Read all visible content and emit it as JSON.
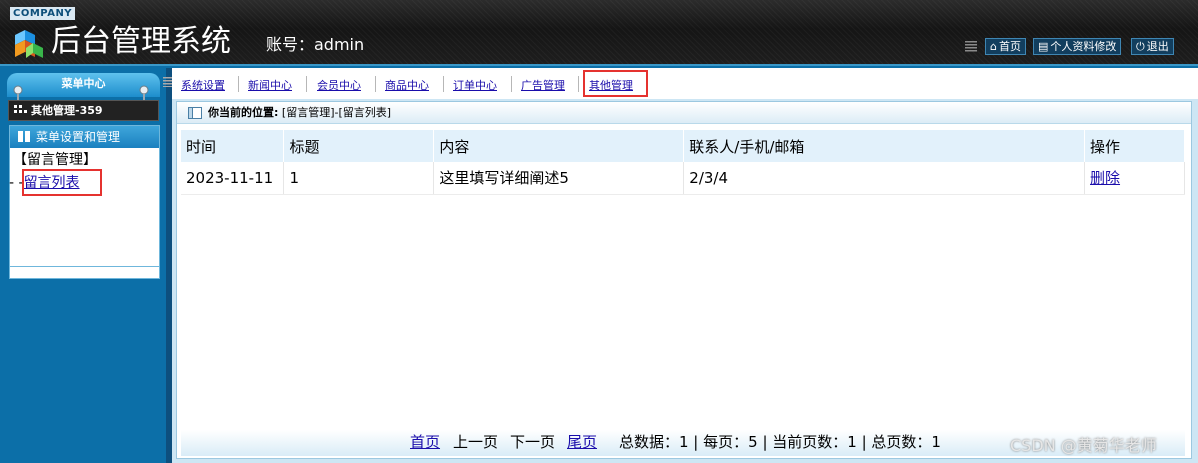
{
  "header": {
    "company": "COMPANY",
    "title": "后台管理系统",
    "account": "账号：admin",
    "buttons": [
      {
        "label": "首页",
        "icon": "home-icon"
      },
      {
        "label": "个人资料修改",
        "icon": "profile-icon"
      },
      {
        "label": "退出",
        "icon": "power-icon"
      }
    ]
  },
  "sidebar": {
    "menu_center": "菜单中心",
    "section": "其他管理-359",
    "panel_title": "菜单设置和管理",
    "group": "【留言管理】",
    "item_prefix": "- -",
    "item": "留言列表"
  },
  "nav": {
    "tabs": [
      "系统设置",
      "新闻中心",
      "会员中心",
      "商品中心",
      "订单中心",
      "广告管理",
      "其他管理"
    ]
  },
  "breadcrumb": {
    "prefix": "你当前的位置:",
    "path": "[留言管理]-[留言列表]"
  },
  "table": {
    "headers": [
      "时间",
      "标题",
      "内容",
      "联系人/手机/邮箱",
      "操作"
    ],
    "rows": [
      {
        "time": "2023-11-11",
        "title": "1",
        "content": "这里填写详细阐述5",
        "contact": "2/3/4",
        "action": "删除"
      }
    ]
  },
  "pager": {
    "first": "首页",
    "prev": "上一页",
    "next": "下一页",
    "last": "尾页",
    "stats": "总数据：1 | 每页：5 | 当前页数：1 | 总页数：1"
  },
  "watermark": "CSDN @黄菊华老师",
  "colors": {
    "header_bg": "#1a1a1a",
    "sidebar_bg": "#0c6fa8",
    "link": "#1a0dab",
    "highlight": "#e5322f",
    "table_header_bg": "#e2f1fb"
  }
}
